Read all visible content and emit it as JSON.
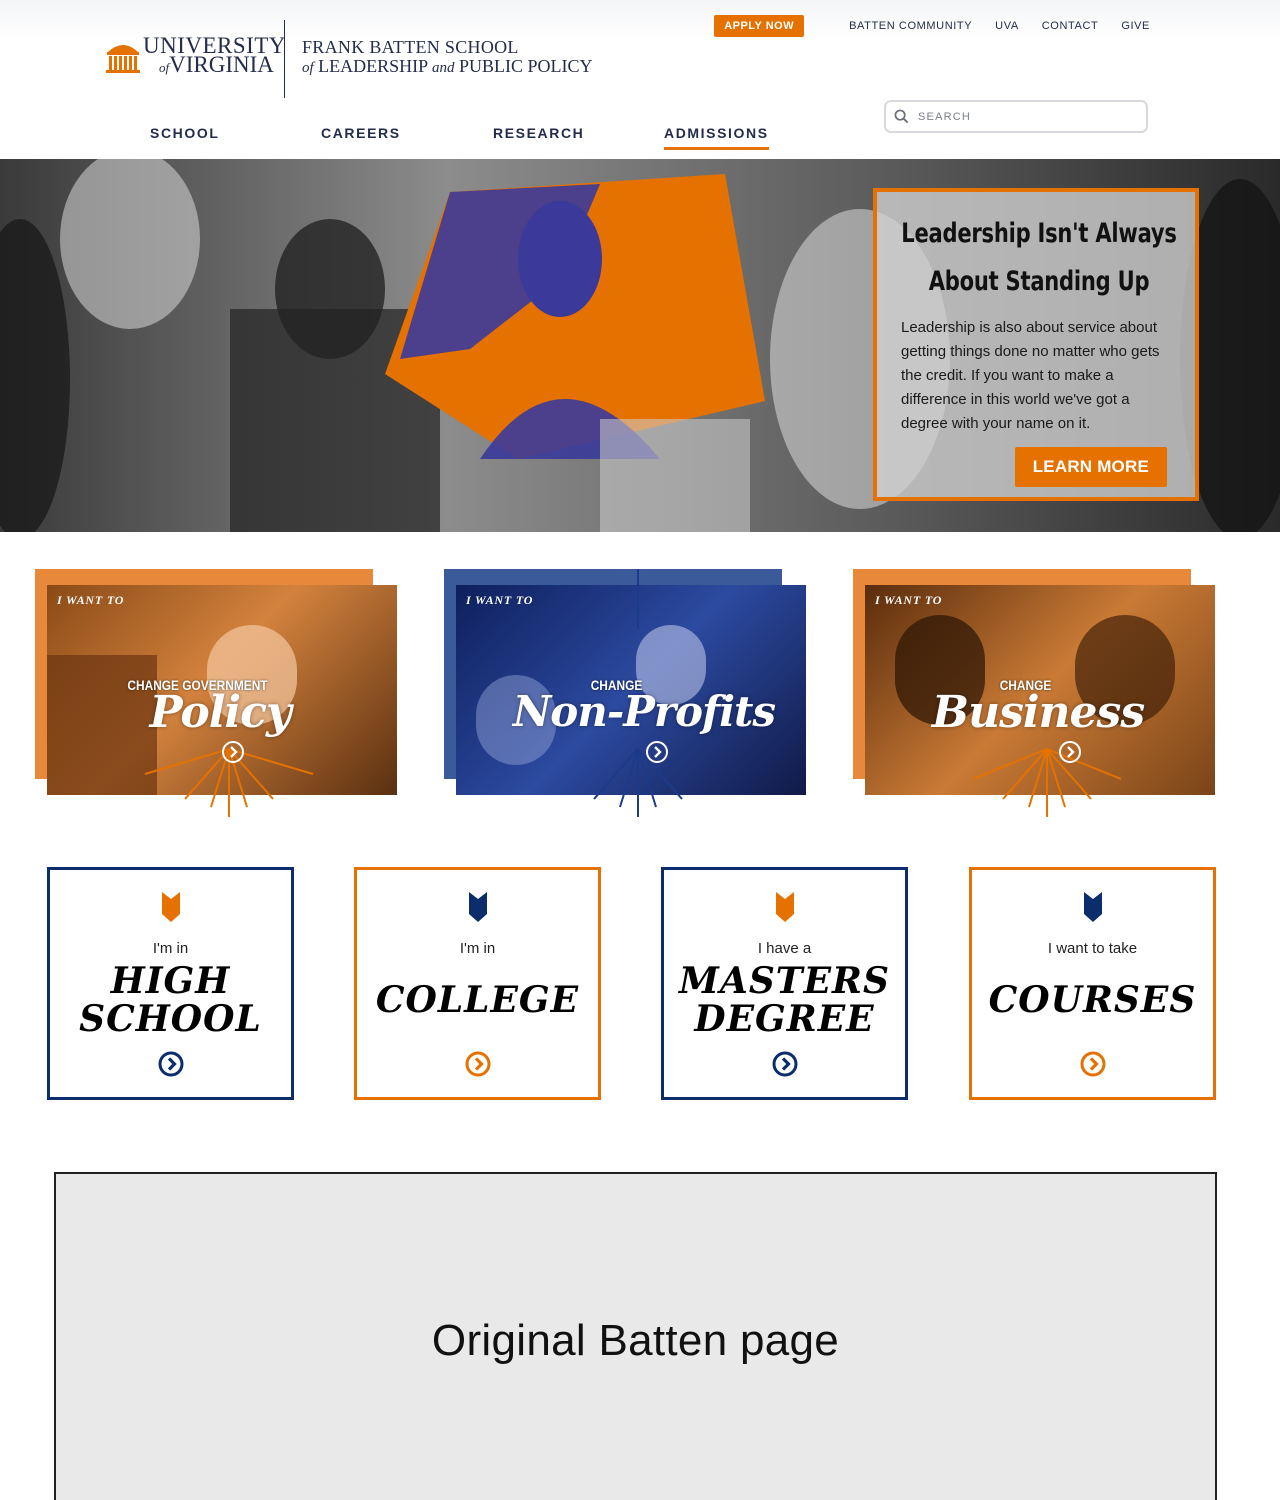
{
  "header": {
    "logo": {
      "uva_line1": "UNIVERSITY",
      "uva_line2": "VIRGINIA",
      "uva_of": "of",
      "school_line1": "FRANK BATTEN SCHOOL",
      "school_of": "of",
      "school_line2a": "LEADERSHIP",
      "school_and": "and",
      "school_line2b": "PUBLIC POLICY"
    },
    "utility": {
      "apply": "APPLY NOW",
      "links": [
        "BATTEN COMMUNITY",
        "UVA",
        "CONTACT",
        "GIVE"
      ]
    },
    "search": {
      "placeholder": "SEARCH",
      "icon": "search-icon"
    },
    "nav": [
      {
        "label": "SCHOOL",
        "active": false
      },
      {
        "label": "CAREERS",
        "active": false
      },
      {
        "label": "RESEARCH",
        "active": false
      },
      {
        "label": "ADMISSIONS",
        "active": true
      }
    ]
  },
  "hero": {
    "title_line1": "Leadership Isn't Always",
    "title_line2": "About Standing Up",
    "body": "Leadership is also about service about getting things done no matter who gets the credit. If you want to make a difference in this world we've got a degree with your name on it.",
    "button": "LEARN MORE"
  },
  "tiles": [
    {
      "eyebrow": "I WANT TO",
      "kicker": "CHANGE GOVERNMENT",
      "big": "Policy",
      "theme": "orange"
    },
    {
      "eyebrow": "I WANT TO",
      "kicker": "CHANGE",
      "big": "Non-Profits",
      "theme": "blue"
    },
    {
      "eyebrow": "I WANT TO",
      "kicker": "CHANGE",
      "big": "Business",
      "theme": "orange"
    }
  ],
  "audiences": [
    {
      "pre": "I'm in",
      "label_lines": [
        "HIGH",
        "SCHOOL"
      ],
      "theme": "blue"
    },
    {
      "pre": "I'm in",
      "label_lines": [
        "COLLEGE"
      ],
      "theme": "orange"
    },
    {
      "pre": "I have a",
      "label_lines": [
        "MASTERS",
        "DEGREE"
      ],
      "theme": "blue"
    },
    {
      "pre": "I want to take",
      "label_lines": [
        "COURSES"
      ],
      "theme": "orange"
    }
  ],
  "placeholder": {
    "text": "Original Batten page"
  },
  "colors": {
    "orange": "#e57200",
    "navy": "#232d4b",
    "blue": "#0b2d6b"
  }
}
